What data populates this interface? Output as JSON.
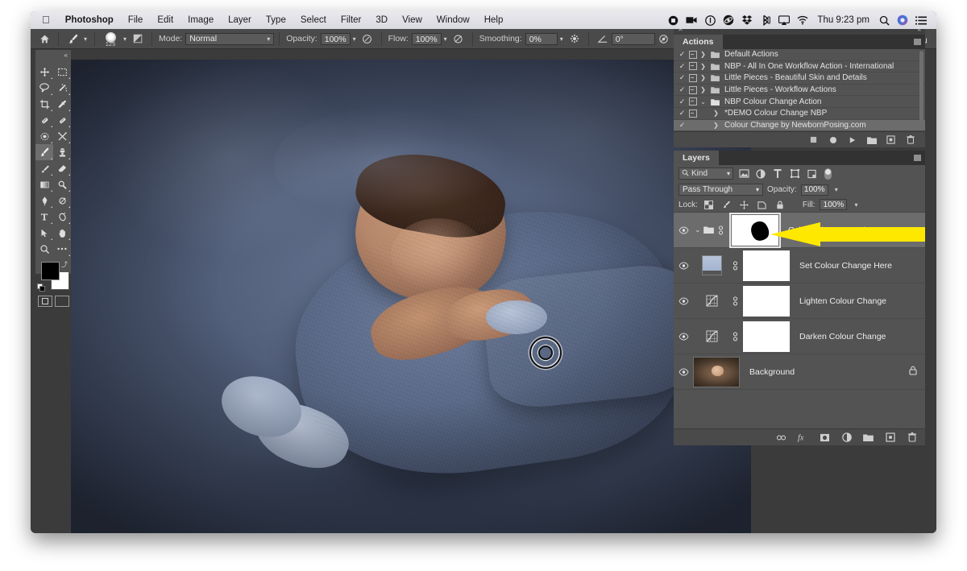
{
  "app": {
    "name": "Photoshop",
    "clock": "Thu 9:23 pm"
  },
  "menubar": {
    "apple": "apple-logo",
    "items": [
      "Photoshop",
      "File",
      "Edit",
      "Image",
      "Layer",
      "Type",
      "Select",
      "Filter",
      "3D",
      "View",
      "Window",
      "Help"
    ],
    "status_icons": [
      "record-stop-icon",
      "screen-record-icon",
      "info-circle-icon",
      "flux-icon",
      "dropbox-icon",
      "bluetooth-icon",
      "airplay-icon",
      "wifi-icon"
    ],
    "search_icon": "search-icon",
    "siri_icon": "siri-icon",
    "notification_icon": "notification-center-icon"
  },
  "options_bar": {
    "home_icon": "home-icon",
    "tool_icon": "brush-tool-icon",
    "brush_size": "125",
    "brush_preset_icon": "brush-preset-picker-icon",
    "toggle_brush_panel_icon": "brush-panel-toggle-icon",
    "mode_label": "Mode:",
    "mode_value": "Normal",
    "opacity_label": "Opacity:",
    "opacity_value": "100%",
    "pressure_opacity_icon": "pressure-opacity-icon",
    "flow_label": "Flow:",
    "flow_value": "100%",
    "airbrush_icon": "airbrush-icon",
    "smoothing_label": "Smoothing:",
    "smoothing_value": "0%",
    "smoothing_options_icon": "smoothing-options-icon",
    "angle_icon": "brush-angle-icon",
    "angle_value": "0°",
    "pressure_size_icon": "pressure-size-icon",
    "symmetry_icon": "symmetry-icon",
    "search_icon": "search-icon",
    "workspace_icon": "workspace-switcher-icon",
    "share_icon": "share-icon"
  },
  "toolbar": {
    "collapse_icon": "collapse-panel-icon",
    "tools": [
      {
        "name": "move-tool",
        "icon": "move-icon",
        "selected": false
      },
      {
        "name": "rectangular-marquee-tool",
        "icon": "marquee-icon",
        "selected": false
      },
      {
        "name": "lasso-tool",
        "icon": "lasso-icon",
        "selected": false
      },
      {
        "name": "magic-wand-tool",
        "icon": "magic-wand-icon",
        "selected": false
      },
      {
        "name": "crop-tool",
        "icon": "crop-icon",
        "selected": false
      },
      {
        "name": "eyedropper-tool",
        "icon": "eyedropper-icon",
        "selected": false
      },
      {
        "name": "spot-healing-brush-tool",
        "icon": "healing-brush-icon",
        "selected": false
      },
      {
        "name": "patch-tool",
        "icon": "patch-icon",
        "selected": false
      },
      {
        "name": "blur-tool",
        "icon": "blur-icon",
        "selected": false
      },
      {
        "name": "mixer-tool",
        "icon": "mixer-icon",
        "selected": false
      },
      {
        "name": "brush-tool",
        "icon": "brush-icon",
        "selected": true
      },
      {
        "name": "clone-stamp-tool",
        "icon": "clone-stamp-icon",
        "selected": false
      },
      {
        "name": "history-brush-tool",
        "icon": "history-brush-icon",
        "selected": false
      },
      {
        "name": "eraser-tool",
        "icon": "eraser-icon",
        "selected": false
      },
      {
        "name": "gradient-tool",
        "icon": "gradient-icon",
        "selected": false
      },
      {
        "name": "dodge-tool",
        "icon": "dodge-icon",
        "selected": false
      },
      {
        "name": "pen-tool",
        "icon": "pen-icon",
        "selected": false
      },
      {
        "name": "blur-sharpen-tool",
        "icon": "sharpen-icon",
        "selected": false
      },
      {
        "name": "type-tool",
        "icon": "type-icon",
        "selected": false
      },
      {
        "name": "ellipse-tool",
        "icon": "ellipse-icon",
        "selected": false
      },
      {
        "name": "path-selection-tool",
        "icon": "path-selection-icon",
        "selected": false
      },
      {
        "name": "hand-tool",
        "icon": "hand-icon",
        "selected": false
      },
      {
        "name": "zoom-tool",
        "icon": "zoom-icon",
        "selected": false
      },
      {
        "name": "edit-toolbar",
        "icon": "more-tools-icon",
        "selected": false
      }
    ],
    "foreground_color": "#000000",
    "background_color": "#ffffff",
    "swap_icon": "swap-colors-icon",
    "default_icon": "default-colors-icon",
    "quickmask_icons": [
      "standard-mode-icon",
      "quick-mask-mode-icon"
    ]
  },
  "canvas": {
    "brush_cursor": "brush-cursor"
  },
  "actions_panel": {
    "close_icon": "close-icon",
    "collapse_icon": "collapse-icon",
    "tab_label": "Actions",
    "menu_icon": "panel-menu-icon",
    "rows": [
      {
        "label": "Default Actions",
        "checked": true,
        "has_box": true,
        "is_folder": true,
        "expanded": false,
        "selected": false
      },
      {
        "label": "NBP - All In One Workflow Action - International",
        "checked": true,
        "has_box": true,
        "is_folder": true,
        "expanded": false,
        "selected": false
      },
      {
        "label": "Little Pieces - Beautiful Skin and Details",
        "checked": true,
        "has_box": true,
        "is_folder": true,
        "expanded": false,
        "selected": false
      },
      {
        "label": "Little Pieces - Workflow Actions",
        "checked": true,
        "has_box": true,
        "is_folder": true,
        "expanded": false,
        "selected": false
      },
      {
        "label": "NBP Colour Change Action",
        "checked": true,
        "has_box": true,
        "is_folder": true,
        "expanded": true,
        "selected": false
      },
      {
        "label": "*DEMO Colour Change NBP",
        "checked": true,
        "has_box": true,
        "is_folder": false,
        "expanded": false,
        "selected": false
      },
      {
        "label": "Colour Change by NewbornPosing.com",
        "checked": true,
        "has_box": false,
        "is_folder": false,
        "expanded": false,
        "selected": true
      }
    ],
    "buttons": [
      "stop-icon",
      "record-icon",
      "play-icon",
      "new-set-icon",
      "new-action-icon",
      "delete-icon"
    ]
  },
  "layers_panel": {
    "tab_label": "Layers",
    "menu_icon": "panel-menu-icon",
    "filter": {
      "search_icon": "search-icon",
      "kind_label": "Kind",
      "caret_icon": "chevron-down-icon",
      "filter_icons": [
        "filter-pixel-icon",
        "filter-adjustment-icon",
        "filter-type-icon",
        "filter-shape-icon",
        "filter-smart-object-icon"
      ],
      "toggle_icon": "filter-toggle-switch"
    },
    "blend_mode": "Pass Through",
    "opacity_label": "Opacity:",
    "opacity_value": "100%",
    "lock_label": "Lock:",
    "lock_icons": [
      "lock-transparency-icon",
      "lock-image-icon",
      "lock-position-icon",
      "lock-artboard-icon",
      "lock-all-icon"
    ],
    "fill_label": "Fill:",
    "fill_value": "100%",
    "layers": [
      {
        "name": "Colour Change Mask",
        "type": "group",
        "visible": true,
        "selected": true,
        "thumb": "mask-with-black-blob",
        "linked": true,
        "expanded": true
      },
      {
        "name": "Set Colour Change Here",
        "type": "solid-color",
        "visible": true,
        "selected": false,
        "thumb": "solid-color-swatch",
        "linked": true
      },
      {
        "name": "Lighten Colour Change",
        "type": "curves",
        "visible": true,
        "selected": false,
        "thumb": "white-mask",
        "linked": true
      },
      {
        "name": "Darken Colour Change",
        "type": "curves",
        "visible": true,
        "selected": false,
        "thumb": "white-mask",
        "linked": true
      },
      {
        "name": "Background",
        "type": "image",
        "visible": true,
        "selected": false,
        "thumb": "baby-photo",
        "locked": true
      }
    ],
    "buttons": [
      "link-layers-icon",
      "layer-style-fx-icon",
      "add-mask-icon",
      "adjustment-layer-icon",
      "new-group-icon",
      "new-layer-icon",
      "delete-layer-icon"
    ]
  },
  "annotation": {
    "arrow_color": "#FFE800",
    "arrow_name": "yellow-pointer-arrow",
    "points_to": "Colour Change Mask"
  }
}
